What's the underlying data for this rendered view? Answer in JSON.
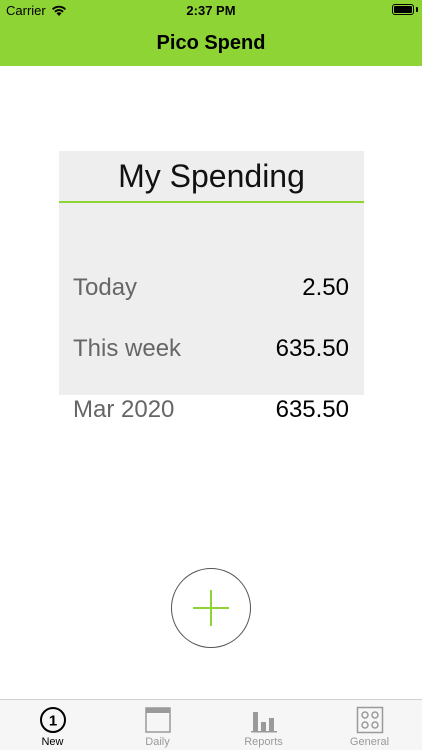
{
  "status_bar": {
    "carrier": "Carrier",
    "time": "2:37 PM"
  },
  "nav": {
    "title": "Pico Spend"
  },
  "card": {
    "title": "My Spending",
    "rows": [
      {
        "label": "Today",
        "value": "2.50"
      },
      {
        "label": "This week",
        "value": "635.50"
      },
      {
        "label": "Mar 2020",
        "value": "635.50"
      }
    ]
  },
  "add_button": {
    "icon": "plus-icon"
  },
  "tabs": [
    {
      "label": "New",
      "icon": "new-number-icon",
      "badge": "1",
      "active": true
    },
    {
      "label": "Daily",
      "icon": "calendar-icon",
      "active": false
    },
    {
      "label": "Reports",
      "icon": "bar-chart-icon",
      "active": false
    },
    {
      "label": "General",
      "icon": "settings-grid-icon",
      "active": false
    }
  ],
  "colors": {
    "accent": "#8fd435",
    "card_bg": "#eeeeee",
    "label_gray": "#666666",
    "tab_inactive": "#9a9a9a"
  }
}
